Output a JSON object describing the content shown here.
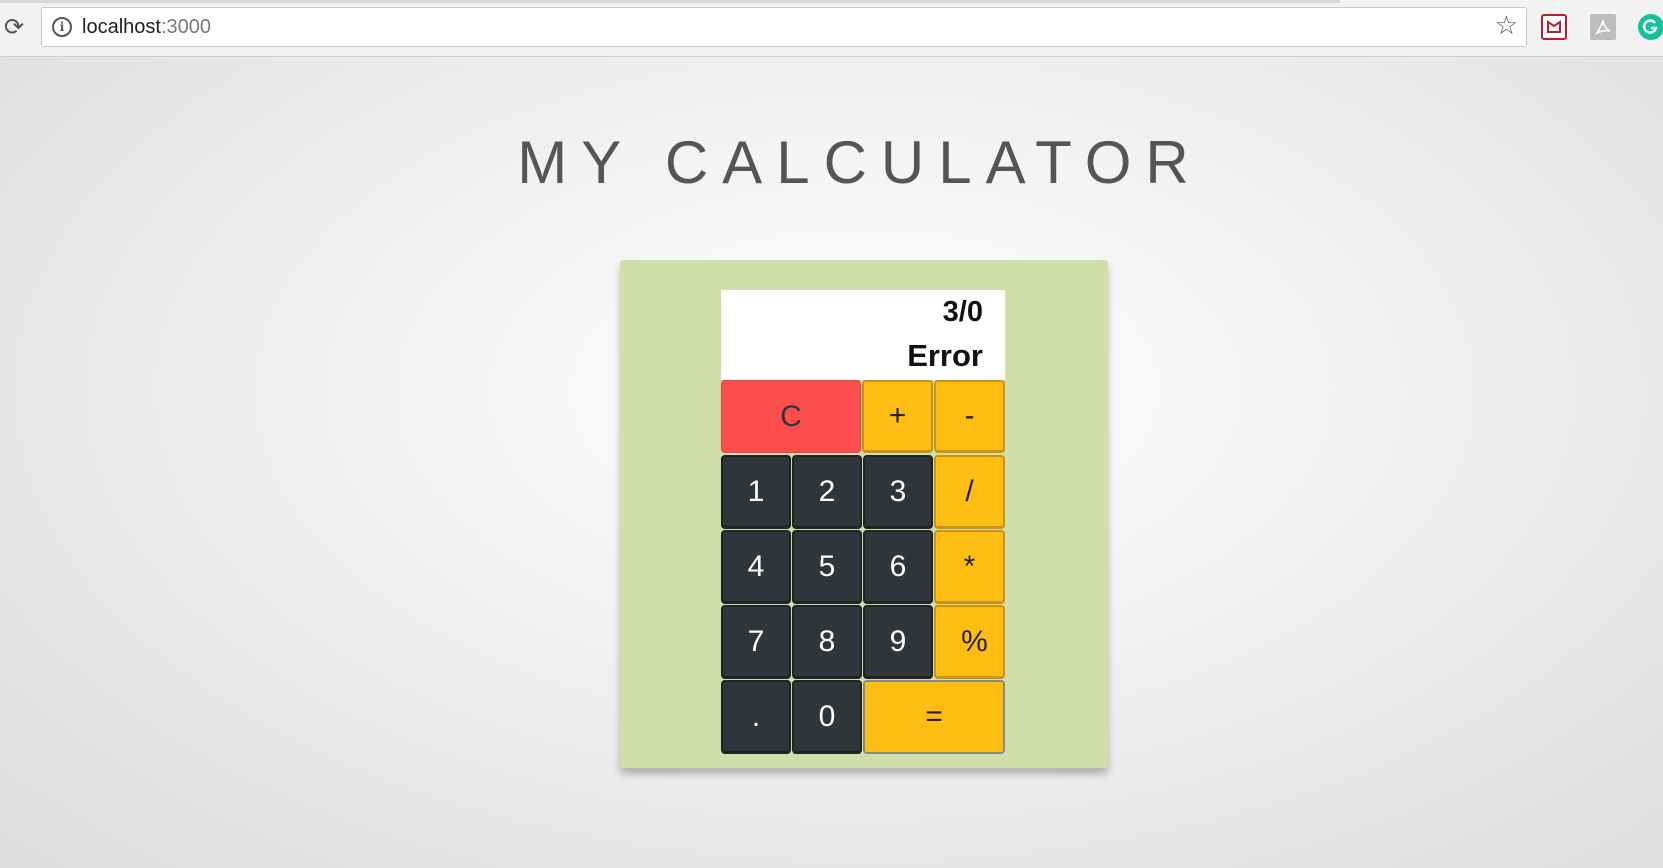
{
  "browser": {
    "url_host": "localhost",
    "url_port": ":3000",
    "reload_glyph": "⟳",
    "star_glyph": "☆",
    "info_glyph": "i"
  },
  "page": {
    "title": "MY CALCULATOR"
  },
  "display": {
    "expression": "3/0",
    "result": "Error"
  },
  "keys": {
    "clear": "C",
    "plus": "+",
    "minus": "-",
    "one": "1",
    "two": "2",
    "three": "3",
    "divide": "/",
    "four": "4",
    "five": "5",
    "six": "6",
    "multiply": "*",
    "seven": "7",
    "eight": "8",
    "nine": "9",
    "percent": "%",
    "decimal": ".",
    "zero": "0",
    "equals": "="
  },
  "colors": {
    "panel": "#d1deab",
    "number_keys": "#31353a",
    "operator_keys": "#fdbd12",
    "clear_key": "#fd4e4e",
    "display_bg": "#ffffff",
    "title_text": "#555555"
  }
}
